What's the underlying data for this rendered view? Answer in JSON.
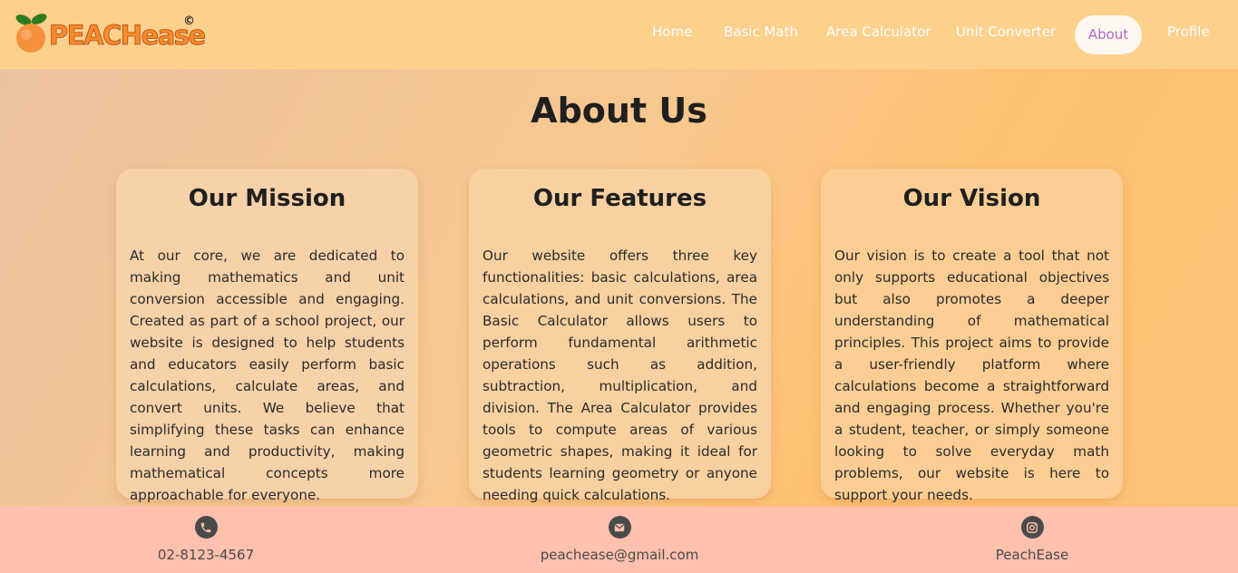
{
  "header": {
    "logo_text": "PEACHease",
    "logo_mark": "©",
    "nav": [
      {
        "label": "Home"
      },
      {
        "label": "Basic Math"
      },
      {
        "label": "Area Calculator"
      },
      {
        "label": "Unit Converter"
      },
      {
        "label": "About",
        "active": true
      },
      {
        "label": "Profile"
      }
    ]
  },
  "main": {
    "title": "About Us",
    "cards": [
      {
        "heading": "Our Mission",
        "text": "At our core, we are dedicated to making mathematics and unit conversion accessible and engaging. Created as part of a school project, our website is designed to help students and educators easily perform basic calculations, calculate areas, and convert units. We believe that simplifying these tasks can enhance learning and productivity, making mathematical concepts more approachable for everyone."
      },
      {
        "heading": "Our Features",
        "text": "Our website offers three key functionalities: basic calculations, area calculations, and unit conversions. The Basic Calculator allows users to perform fundamental arithmetic operations such as addition, subtraction, multiplication, and division. The Area Calculator provides tools to compute areas of various geometric shapes, making it ideal for students learning geometry or anyone needing quick calculations."
      },
      {
        "heading": "Our Vision",
        "text": "Our vision is to create a tool that not only supports educational objectives but also promotes a deeper understanding of mathematical principles. This project aims to provide a user-friendly platform where calculations become a straightforward and engaging process. Whether you're a student, teacher, or simply someone looking to solve everyday math problems, our website is here to support your needs."
      }
    ]
  },
  "footer": {
    "phone": "02-8123-4567",
    "email": "peachease@gmail.com",
    "instagram": "PeachEase"
  },
  "icons": {
    "logo": "peach-icon",
    "phone": "phone-icon",
    "email": "mail-icon",
    "instagram": "instagram-icon"
  },
  "colors": {
    "header_bg": "#fdd08c",
    "footer_bg": "#ffc0ae",
    "active_nav_text": "#b069c8",
    "brand_orange": "#ff8a2b"
  }
}
